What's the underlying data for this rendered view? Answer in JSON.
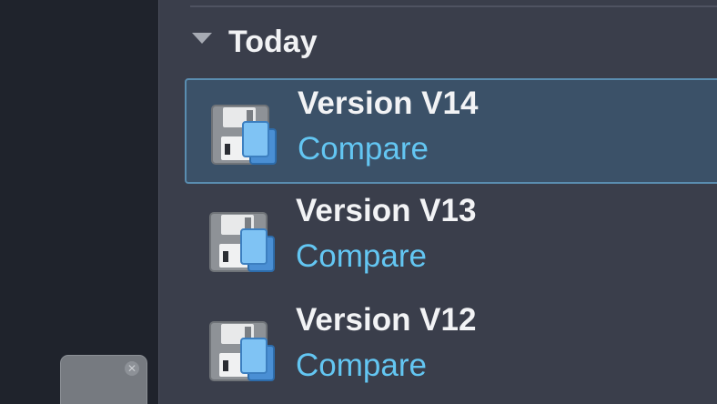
{
  "history": {
    "group_label": "Today",
    "versions": [
      {
        "title": "Version V14",
        "action": "Compare",
        "selected": true
      },
      {
        "title": "Version V13",
        "action": "Compare",
        "selected": false
      },
      {
        "title": "Version V12",
        "action": "Compare",
        "selected": false
      }
    ]
  },
  "icons": {
    "group_toggle": "triangle-down-icon",
    "version": "save-copy-icon",
    "mini_panel_close": "close-icon"
  },
  "colors": {
    "panel_bg": "#3a3e4b",
    "selected_bg": "#3b5168",
    "selected_border": "#5a8db0",
    "link": "#63c6f2"
  }
}
